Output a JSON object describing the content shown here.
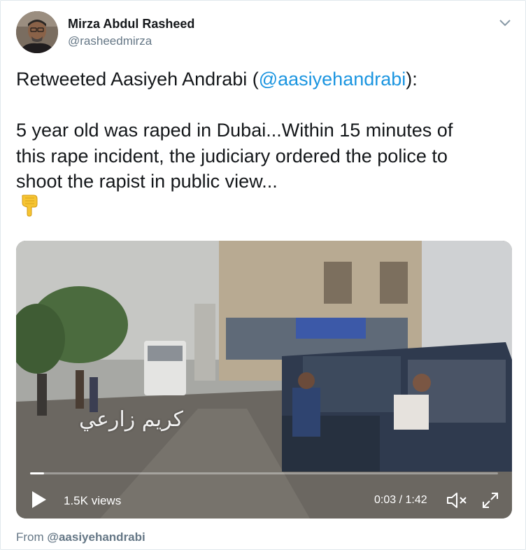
{
  "author": {
    "name": "Mirza Abdul Rasheed",
    "handle": "@rasheedmirza"
  },
  "tweet": {
    "prefix": "Retweeted Aasiyeh Andrabi (",
    "mention": "@aasiyehandrabi",
    "suffix": "):",
    "body": "5 year old was raped in Dubai...Within 15 minutes of\nthis rape incident, the judiciary ordered the police to\nshoot the rapist in public view...",
    "emoji": "backhand-index-pointing-down"
  },
  "video": {
    "watermark": "كريم زارعي",
    "views": "1.5K views",
    "time": "0:03 / 1:42",
    "progress": 0.03
  },
  "source": {
    "label": "From ",
    "handle": "@aasiyehandrabi"
  },
  "colors": {
    "link": "#1b95e0",
    "secondary_text": "#657786",
    "border": "#e1e8ed"
  }
}
